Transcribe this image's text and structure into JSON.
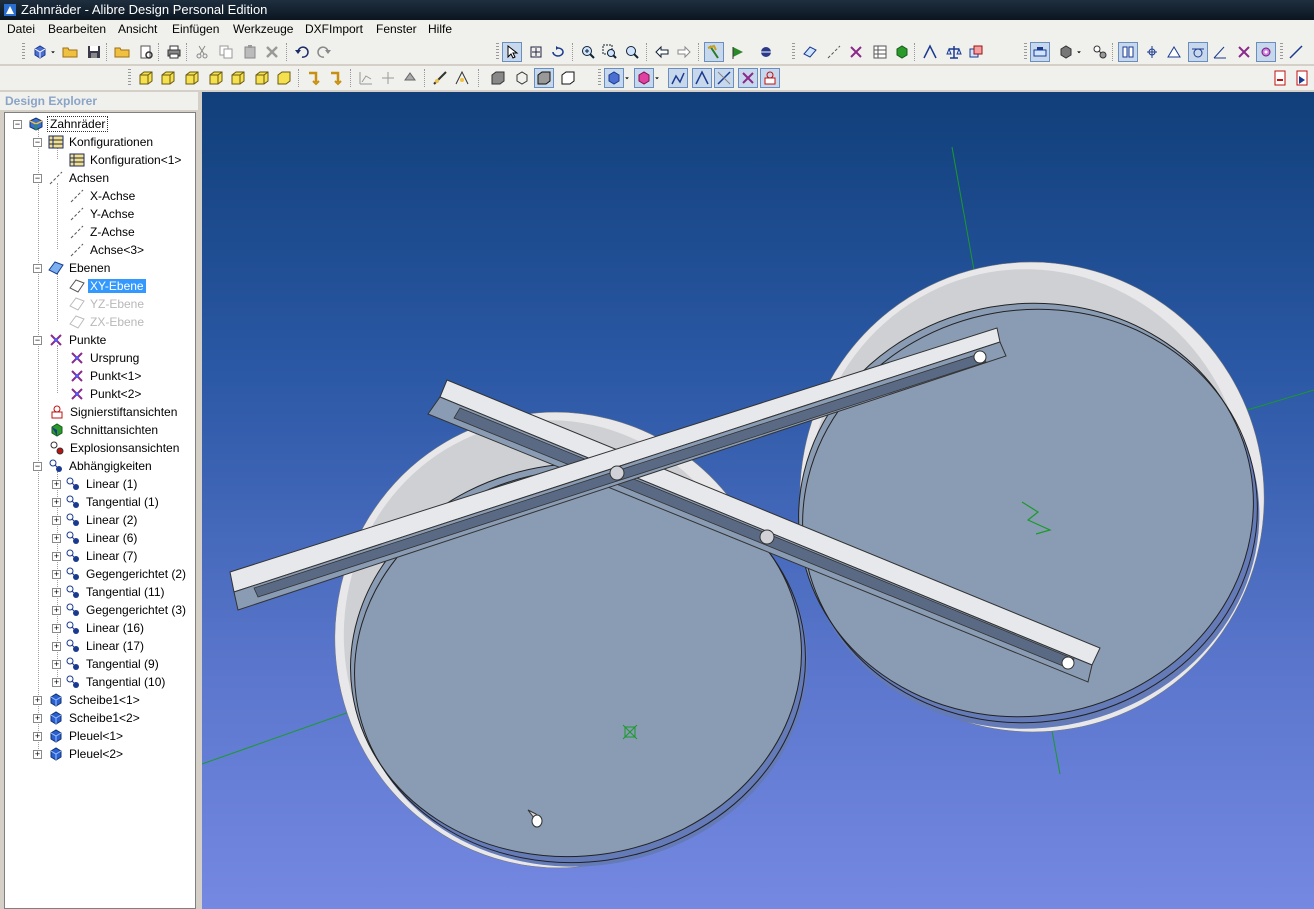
{
  "window": {
    "title": "Zahnräder - Alibre Design Personal Edition"
  },
  "menu": [
    "Datei",
    "Bearbeiten",
    "Ansicht",
    "Einfügen",
    "Werkzeuge",
    "DXFImport",
    "Fenster",
    "Hilfe"
  ],
  "explorer": {
    "header": "Design Explorer",
    "root": "Zahnräder",
    "nodes": {
      "konfigurationen": "Konfigurationen",
      "konfiguration1": "Konfiguration<1>",
      "achsen": "Achsen",
      "x_achse": "X-Achse",
      "y_achse": "Y-Achse",
      "z_achse": "Z-Achse",
      "achse3": "Achse<3>",
      "ebenen": "Ebenen",
      "xy_ebene": "XY-Ebene",
      "yz_ebene": "YZ-Ebene",
      "zx_ebene": "ZX-Ebene",
      "punkte": "Punkte",
      "ursprung": "Ursprung",
      "punkt1": "Punkt<1>",
      "punkt2": "Punkt<2>",
      "signierstift": "Signierstiftansichten",
      "schnitt": "Schnittansichten",
      "explosion": "Explosionsansichten",
      "abhaengigkeiten": "Abhängigkeiten",
      "scheibe1": "Scheibe1<1>",
      "scheibe2": "Scheibe1<2>",
      "pleuel1": "Pleuel<1>",
      "pleuel2": "Pleuel<2>"
    },
    "constraints": [
      "Linear (1)",
      "Tangential (1)",
      "Linear (2)",
      "Linear (6)",
      "Linear (7)",
      "Gegengerichtet (2)",
      "Tangential (11)",
      "Gegengerichtet (3)",
      "Linear (16)",
      "Linear (17)",
      "Tangential (9)",
      "Tangential (10)"
    ]
  },
  "colors": {
    "accent": "#3399ff",
    "viewport_top": "#103f7a",
    "viewport_bottom": "#7588e2",
    "part": "#8a9cb4",
    "axis": "#1a9a2a"
  }
}
